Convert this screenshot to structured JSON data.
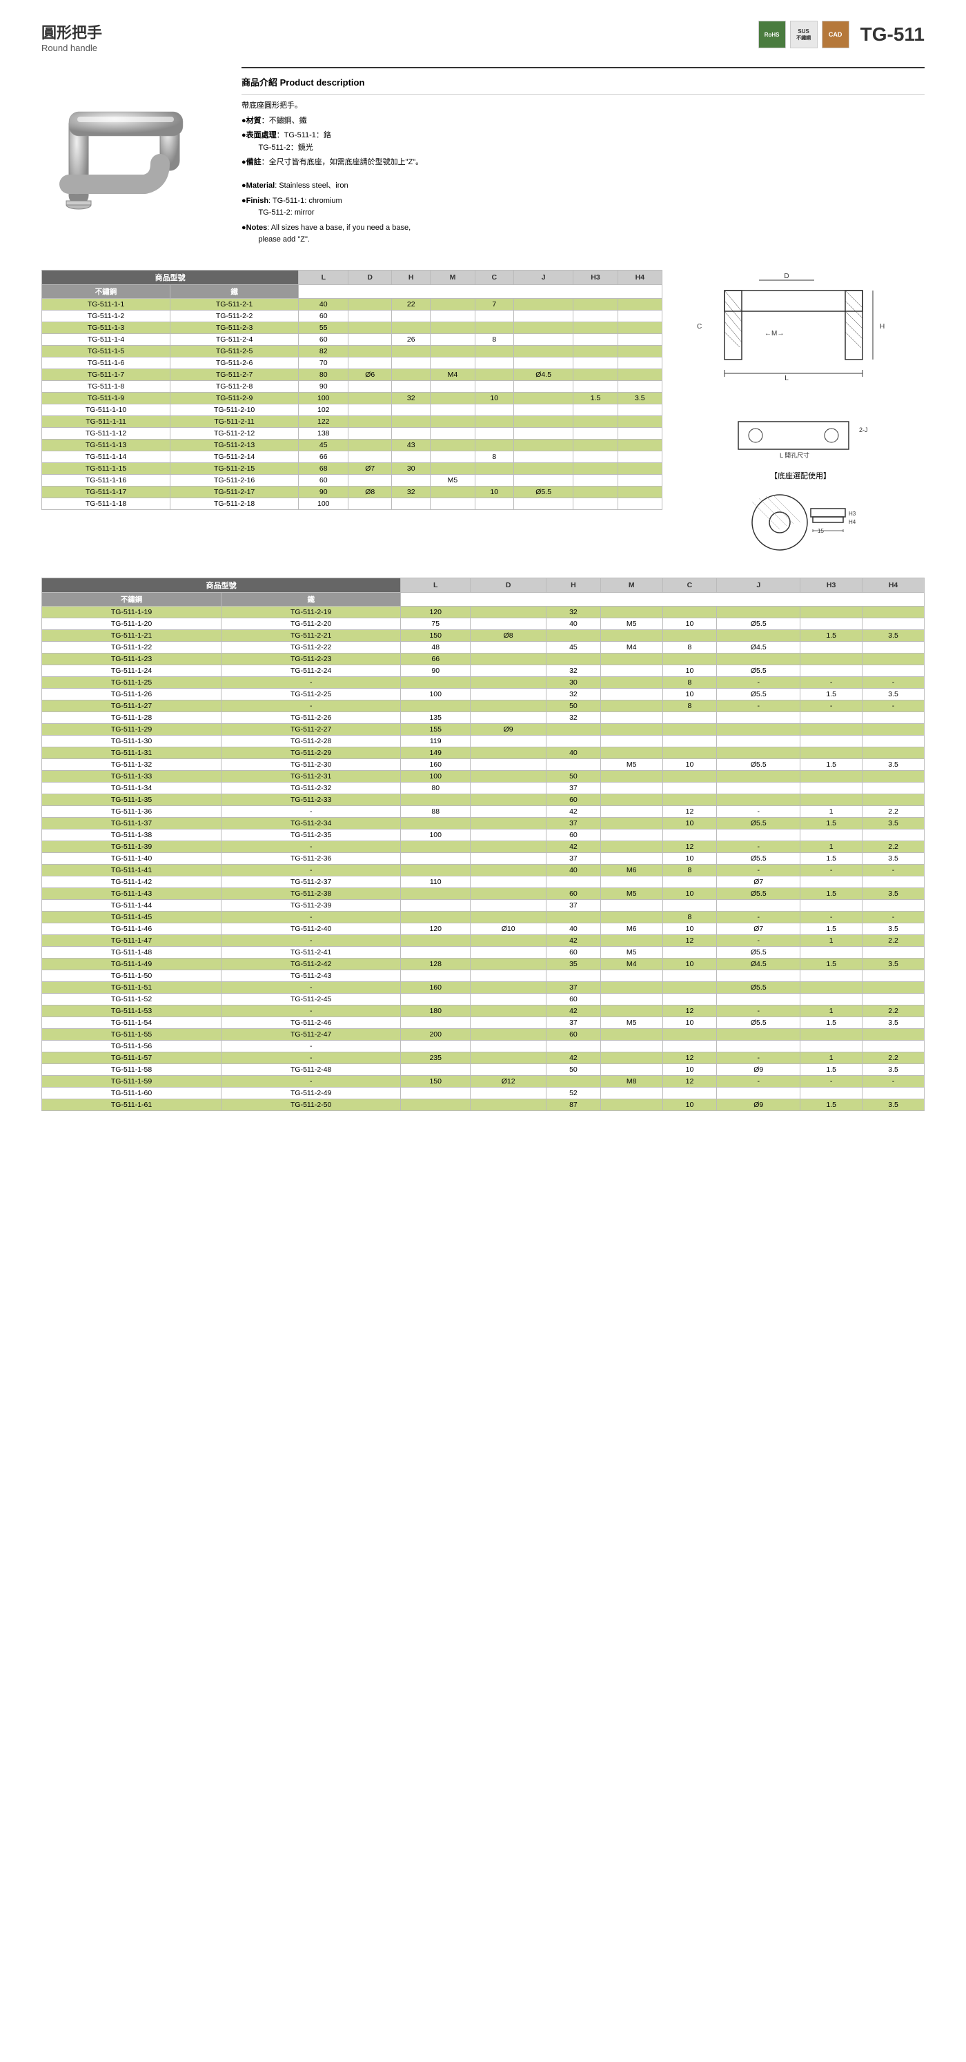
{
  "header": {
    "title_zh": "圓形把手",
    "title_en": "Round handle",
    "product_code": "TG-511",
    "badges": [
      {
        "label": "RoHS",
        "type": "rohs"
      },
      {
        "label": "SUS\n不鏽鋼",
        "type": "sus"
      },
      {
        "label": "CAD",
        "type": "cad"
      }
    ]
  },
  "description": {
    "title": "商品介紹 Product description",
    "line1": "帶底座圓形把手。",
    "items": [
      "材質：不鏽鋼、鐵",
      "表面處理：TG-511-1：鉻　　TG-511-2：鏡光",
      "備註：全尺寸皆有底座，如需底座請於型號加上\"Z\"。",
      "Material: Stainless steel、iron",
      "Finish: TG-511-1: chromium　　TG-511-2: mirror",
      "Notes: All sizes have a base, if you need a base, please add \"Z\"."
    ]
  },
  "table1": {
    "section_label": "商品型號",
    "sub_headers": [
      "不鏽鋼",
      "鐵"
    ],
    "dim_headers": [
      "L",
      "D",
      "H",
      "M",
      "C",
      "J",
      "H3",
      "H4"
    ],
    "rows": [
      {
        "ss": "TG-511-1-1",
        "fe": "TG-511-2-1",
        "L": "40",
        "D": "",
        "H": "22",
        "M": "",
        "C": "7",
        "J": "",
        "H3": "",
        "H4": "",
        "green": true
      },
      {
        "ss": "TG-511-1-2",
        "fe": "TG-511-2-2",
        "L": "60",
        "D": "",
        "H": "",
        "M": "",
        "C": "",
        "J": "",
        "H3": "",
        "H4": "",
        "green": false
      },
      {
        "ss": "TG-511-1-3",
        "fe": "TG-511-2-3",
        "L": "55",
        "D": "",
        "H": "",
        "M": "",
        "C": "",
        "J": "",
        "H3": "",
        "H4": "",
        "green": true
      },
      {
        "ss": "TG-511-1-4",
        "fe": "TG-511-2-4",
        "L": "60",
        "D": "",
        "H": "26",
        "M": "",
        "C": "8",
        "J": "",
        "H3": "",
        "H4": "",
        "green": false
      },
      {
        "ss": "TG-511-1-5",
        "fe": "TG-511-2-5",
        "L": "82",
        "D": "",
        "H": "",
        "M": "",
        "C": "",
        "J": "",
        "H3": "",
        "H4": "",
        "green": true
      },
      {
        "ss": "TG-511-1-6",
        "fe": "TG-511-2-6",
        "L": "70",
        "D": "",
        "H": "",
        "M": "",
        "C": "",
        "J": "",
        "H3": "",
        "H4": "",
        "green": false
      },
      {
        "ss": "TG-511-1-7",
        "fe": "TG-511-2-7",
        "L": "80",
        "D": "Ø6",
        "H": "",
        "M": "M4",
        "C": "",
        "J": "Ø4.5",
        "H3": "",
        "H4": "",
        "green": true
      },
      {
        "ss": "TG-511-1-8",
        "fe": "TG-511-2-8",
        "L": "90",
        "D": "",
        "H": "",
        "M": "",
        "C": "",
        "J": "",
        "H3": "",
        "H4": "",
        "green": false
      },
      {
        "ss": "TG-511-1-9",
        "fe": "TG-511-2-9",
        "L": "100",
        "D": "",
        "H": "32",
        "M": "",
        "C": "10",
        "J": "",
        "H3": "1.5",
        "H4": "3.5",
        "green": true
      },
      {
        "ss": "TG-511-1-10",
        "fe": "TG-511-2-10",
        "L": "102",
        "D": "",
        "H": "",
        "M": "",
        "C": "",
        "J": "",
        "H3": "",
        "H4": "",
        "green": false
      },
      {
        "ss": "TG-511-1-11",
        "fe": "TG-511-2-11",
        "L": "122",
        "D": "",
        "H": "",
        "M": "",
        "C": "",
        "J": "",
        "H3": "",
        "H4": "",
        "green": true
      },
      {
        "ss": "TG-511-1-12",
        "fe": "TG-511-2-12",
        "L": "138",
        "D": "",
        "H": "",
        "M": "",
        "C": "",
        "J": "",
        "H3": "",
        "H4": "",
        "green": false
      },
      {
        "ss": "TG-511-1-13",
        "fe": "TG-511-2-13",
        "L": "45",
        "D": "",
        "H": "43",
        "M": "",
        "C": "",
        "J": "",
        "H3": "",
        "H4": "",
        "green": true
      },
      {
        "ss": "TG-511-1-14",
        "fe": "TG-511-2-14",
        "L": "66",
        "D": "",
        "H": "",
        "M": "",
        "C": "8",
        "J": "",
        "H3": "",
        "H4": "",
        "green": false
      },
      {
        "ss": "TG-511-1-15",
        "fe": "TG-511-2-15",
        "L": "68",
        "D": "Ø7",
        "H": "30",
        "M": "",
        "C": "",
        "J": "",
        "H3": "",
        "H4": "",
        "green": true
      },
      {
        "ss": "TG-511-1-16",
        "fe": "TG-511-2-16",
        "L": "60",
        "D": "",
        "H": "",
        "M": "M5",
        "C": "",
        "J": "",
        "H3": "",
        "H4": "",
        "green": false
      },
      {
        "ss": "TG-511-1-17",
        "fe": "TG-511-2-17",
        "L": "90",
        "D": "Ø8",
        "H": "32",
        "M": "",
        "C": "10",
        "J": "Ø5.5",
        "H3": "",
        "H4": "",
        "green": true
      },
      {
        "ss": "TG-511-1-18",
        "fe": "TG-511-2-18",
        "L": "100",
        "D": "",
        "H": "",
        "M": "",
        "C": "",
        "J": "",
        "H3": "",
        "H4": "",
        "green": false
      }
    ]
  },
  "table2": {
    "section_label": "商品型號",
    "sub_headers": [
      "不鏽鋼",
      "鐵"
    ],
    "dim_headers": [
      "L",
      "D",
      "H",
      "M",
      "C",
      "J",
      "H3",
      "H4"
    ],
    "rows": [
      {
        "ss": "TG-511-1-19",
        "fe": "TG-511-2-19",
        "L": "120",
        "D": "",
        "H": "32",
        "M": "",
        "C": "",
        "J": "",
        "H3": "",
        "H4": "",
        "green": true
      },
      {
        "ss": "TG-511-1-20",
        "fe": "TG-511-2-20",
        "L": "75",
        "D": "",
        "H": "40",
        "M": "M5",
        "C": "10",
        "J": "Ø5.5",
        "H3": "",
        "H4": "",
        "green": false
      },
      {
        "ss": "TG-511-1-21",
        "fe": "TG-511-2-21",
        "L": "150",
        "D": "Ø8",
        "H": "",
        "M": "",
        "C": "",
        "J": "",
        "H3": "1.5",
        "H4": "3.5",
        "green": true
      },
      {
        "ss": "TG-511-1-22",
        "fe": "TG-511-2-22",
        "L": "48",
        "D": "",
        "H": "45",
        "M": "M4",
        "C": "8",
        "J": "Ø4.5",
        "H3": "",
        "H4": "",
        "green": false
      },
      {
        "ss": "TG-511-1-23",
        "fe": "TG-511-2-23",
        "L": "66",
        "D": "",
        "H": "",
        "M": "",
        "C": "",
        "J": "",
        "H3": "",
        "H4": "",
        "green": true
      },
      {
        "ss": "TG-511-1-24",
        "fe": "TG-511-2-24",
        "L": "90",
        "D": "",
        "H": "32",
        "M": "",
        "C": "10",
        "J": "Ø5.5",
        "H3": "",
        "H4": "",
        "green": false
      },
      {
        "ss": "TG-511-1-25",
        "fe": "-",
        "L": "",
        "D": "",
        "H": "30",
        "M": "",
        "C": "8",
        "J": "-",
        "H3": "-",
        "H4": "-",
        "green": true
      },
      {
        "ss": "TG-511-1-26",
        "fe": "TG-511-2-25",
        "L": "100",
        "D": "",
        "H": "32",
        "M": "",
        "C": "10",
        "J": "Ø5.5",
        "H3": "1.5",
        "H4": "3.5",
        "green": false
      },
      {
        "ss": "TG-511-1-27",
        "fe": "-",
        "L": "",
        "D": "",
        "H": "50",
        "M": "",
        "C": "8",
        "J": "-",
        "H3": "-",
        "H4": "-",
        "green": true
      },
      {
        "ss": "TG-511-1-28",
        "fe": "TG-511-2-26",
        "L": "135",
        "D": "",
        "H": "32",
        "M": "",
        "C": "",
        "J": "",
        "H3": "",
        "H4": "",
        "green": false
      },
      {
        "ss": "TG-511-1-29",
        "fe": "TG-511-2-27",
        "L": "155",
        "D": "Ø9",
        "H": "",
        "M": "",
        "C": "",
        "J": "",
        "H3": "",
        "H4": "",
        "green": true
      },
      {
        "ss": "TG-511-1-30",
        "fe": "TG-511-2-28",
        "L": "119",
        "D": "",
        "H": "",
        "M": "",
        "C": "",
        "J": "",
        "H3": "",
        "H4": "",
        "green": false
      },
      {
        "ss": "TG-511-1-31",
        "fe": "TG-511-2-29",
        "L": "149",
        "D": "",
        "H": "40",
        "M": "",
        "C": "",
        "J": "",
        "H3": "",
        "H4": "",
        "green": true
      },
      {
        "ss": "TG-511-1-32",
        "fe": "TG-511-2-30",
        "L": "160",
        "D": "",
        "H": "",
        "M": "M5",
        "C": "10",
        "J": "Ø5.5",
        "H3": "1.5",
        "H4": "3.5",
        "green": false
      },
      {
        "ss": "TG-511-1-33",
        "fe": "TG-511-2-31",
        "L": "100",
        "D": "",
        "H": "50",
        "M": "",
        "C": "",
        "J": "",
        "H3": "",
        "H4": "",
        "green": true
      },
      {
        "ss": "TG-511-1-34",
        "fe": "TG-511-2-32",
        "L": "80",
        "D": "",
        "H": "37",
        "M": "",
        "C": "",
        "J": "",
        "H3": "",
        "H4": "",
        "green": false
      },
      {
        "ss": "TG-511-1-35",
        "fe": "TG-511-2-33",
        "L": "",
        "D": "",
        "H": "60",
        "M": "",
        "C": "",
        "J": "",
        "H3": "",
        "H4": "",
        "green": true
      },
      {
        "ss": "TG-511-1-36",
        "fe": "-",
        "L": "88",
        "D": "",
        "H": "42",
        "M": "",
        "C": "12",
        "J": "-",
        "H3": "1",
        "H4": "2.2",
        "green": false
      },
      {
        "ss": "TG-511-1-37",
        "fe": "TG-511-2-34",
        "L": "",
        "D": "",
        "H": "37",
        "M": "",
        "C": "10",
        "J": "Ø5.5",
        "H3": "1.5",
        "H4": "3.5",
        "green": true
      },
      {
        "ss": "TG-511-1-38",
        "fe": "TG-511-2-35",
        "L": "100",
        "D": "",
        "H": "60",
        "M": "",
        "C": "",
        "J": "",
        "H3": "",
        "H4": "",
        "green": false
      },
      {
        "ss": "TG-511-1-39",
        "fe": "-",
        "L": "",
        "D": "",
        "H": "42",
        "M": "",
        "C": "12",
        "J": "-",
        "H3": "1",
        "H4": "2.2",
        "green": true
      },
      {
        "ss": "TG-511-1-40",
        "fe": "TG-511-2-36",
        "L": "",
        "D": "",
        "H": "37",
        "M": "",
        "C": "10",
        "J": "Ø5.5",
        "H3": "1.5",
        "H4": "3.5",
        "green": false
      },
      {
        "ss": "TG-511-1-41",
        "fe": "-",
        "L": "",
        "D": "",
        "H": "40",
        "M": "M6",
        "C": "8",
        "J": "-",
        "H3": "-",
        "H4": "-",
        "green": true
      },
      {
        "ss": "TG-511-1-42",
        "fe": "TG-511-2-37",
        "L": "110",
        "D": "",
        "H": "",
        "M": "",
        "C": "",
        "J": "Ø7",
        "H3": "",
        "H4": "",
        "green": false
      },
      {
        "ss": "TG-511-1-43",
        "fe": "TG-511-2-38",
        "L": "",
        "D": "",
        "H": "60",
        "M": "M5",
        "C": "10",
        "J": "Ø5.5",
        "H3": "1.5",
        "H4": "3.5",
        "green": true
      },
      {
        "ss": "TG-511-1-44",
        "fe": "TG-511-2-39",
        "L": "",
        "D": "",
        "H": "37",
        "M": "",
        "C": "",
        "J": "",
        "H3": "",
        "H4": "",
        "green": false
      },
      {
        "ss": "TG-511-1-45",
        "fe": "-",
        "L": "",
        "D": "",
        "H": "",
        "M": "",
        "C": "8",
        "J": "-",
        "H3": "-",
        "H4": "-",
        "green": true
      },
      {
        "ss": "TG-511-1-46",
        "fe": "TG-511-2-40",
        "L": "120",
        "D": "Ø10",
        "H": "40",
        "M": "M6",
        "C": "10",
        "J": "Ø7",
        "H3": "1.5",
        "H4": "3.5",
        "green": false
      },
      {
        "ss": "TG-511-1-47",
        "fe": "-",
        "L": "",
        "D": "",
        "H": "42",
        "M": "",
        "C": "12",
        "J": "-",
        "H3": "1",
        "H4": "2.2",
        "green": true
      },
      {
        "ss": "TG-511-1-48",
        "fe": "TG-511-2-41",
        "L": "",
        "D": "",
        "H": "60",
        "M": "M5",
        "C": "",
        "J": "Ø5.5",
        "H3": "",
        "H4": "",
        "green": false
      },
      {
        "ss": "TG-511-1-49",
        "fe": "TG-511-2-42",
        "L": "128",
        "D": "",
        "H": "35",
        "M": "M4",
        "C": "10",
        "J": "Ø4.5",
        "H3": "1.5",
        "H4": "3.5",
        "green": true
      },
      {
        "ss": "TG-511-1-50",
        "fe": "TG-511-2-43",
        "L": "",
        "D": "",
        "H": "",
        "M": "",
        "C": "",
        "J": "",
        "H3": "",
        "H4": "",
        "green": false
      },
      {
        "ss": "TG-511-1-51",
        "fe": "-",
        "L": "160",
        "D": "",
        "H": "37",
        "M": "",
        "C": "",
        "J": "Ø5.5",
        "H3": "",
        "H4": "",
        "green": true
      },
      {
        "ss": "TG-511-1-52",
        "fe": "TG-511-2-45",
        "L": "",
        "D": "",
        "H": "60",
        "M": "",
        "C": "",
        "J": "",
        "H3": "",
        "H4": "",
        "green": false
      },
      {
        "ss": "TG-511-1-53",
        "fe": "-",
        "L": "180",
        "D": "",
        "H": "42",
        "M": "",
        "C": "12",
        "J": "-",
        "H3": "1",
        "H4": "2.2",
        "green": true
      },
      {
        "ss": "TG-511-1-54",
        "fe": "TG-511-2-46",
        "L": "",
        "D": "",
        "H": "37",
        "M": "M5",
        "C": "10",
        "J": "Ø5.5",
        "H3": "1.5",
        "H4": "3.5",
        "green": false
      },
      {
        "ss": "TG-511-1-55",
        "fe": "TG-511-2-47",
        "L": "200",
        "D": "",
        "H": "60",
        "M": "",
        "C": "",
        "J": "",
        "H3": "",
        "H4": "",
        "green": true
      },
      {
        "ss": "TG-511-1-56",
        "fe": "-",
        "L": "",
        "D": "",
        "H": "",
        "M": "",
        "C": "",
        "J": "",
        "H3": "",
        "H4": "",
        "green": false
      },
      {
        "ss": "TG-511-1-57",
        "fe": "-",
        "L": "235",
        "D": "",
        "H": "42",
        "M": "",
        "C": "12",
        "J": "-",
        "H3": "1",
        "H4": "2.2",
        "green": true
      },
      {
        "ss": "TG-511-1-58",
        "fe": "TG-511-2-48",
        "L": "",
        "D": "",
        "H": "50",
        "M": "",
        "C": "10",
        "J": "Ø9",
        "H3": "1.5",
        "H4": "3.5",
        "green": false
      },
      {
        "ss": "TG-511-1-59",
        "fe": "-",
        "L": "150",
        "D": "Ø12",
        "H": "",
        "M": "M8",
        "C": "12",
        "J": "-",
        "H3": "-",
        "H4": "-",
        "green": true
      },
      {
        "ss": "TG-511-1-60",
        "fe": "TG-511-2-49",
        "L": "",
        "D": "",
        "H": "52",
        "M": "",
        "C": "",
        "J": "",
        "H3": "",
        "H4": "",
        "green": false
      },
      {
        "ss": "TG-511-1-61",
        "fe": "TG-511-2-50",
        "L": "",
        "D": "",
        "H": "87",
        "M": "",
        "C": "10",
        "J": "Ø9",
        "H3": "1.5",
        "H4": "3.5",
        "green": true
      }
    ]
  },
  "diagram": {
    "base_label": "【底座選配使用】",
    "hole_label": "L 開孔尺寸",
    "dim_15": "15",
    "dim_2j": "2-J"
  }
}
